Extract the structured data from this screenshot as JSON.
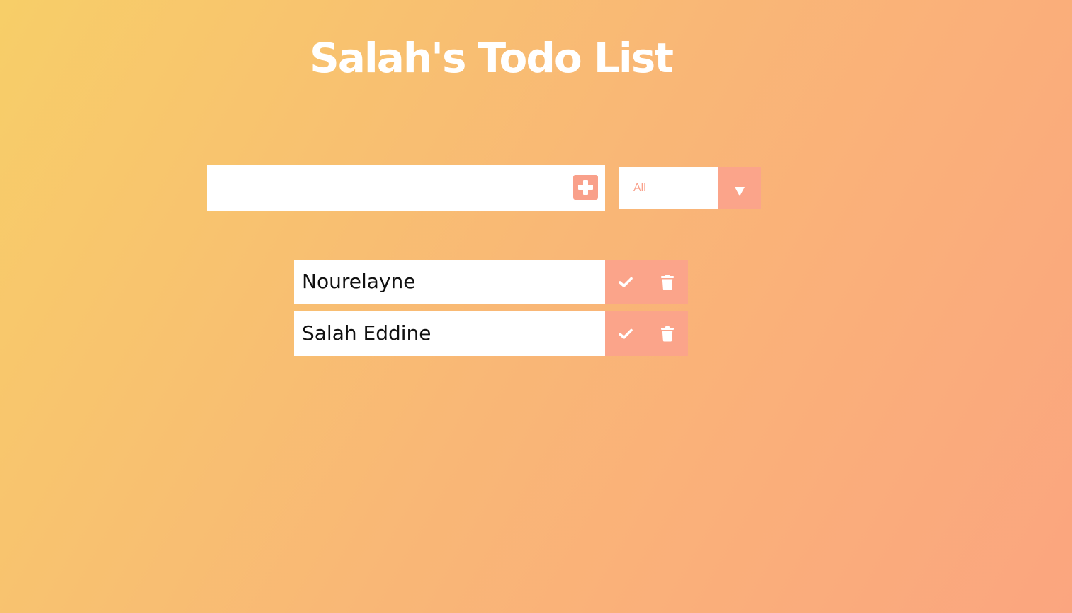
{
  "header": {
    "title": "Salah's Todo List"
  },
  "form": {
    "input_value": "",
    "add_icon": "plus-square-icon"
  },
  "filter": {
    "selected": "All",
    "arrow_icon": "caret-down-icon"
  },
  "todos": [
    {
      "text": "Nourelayne",
      "complete_icon": "check-icon",
      "delete_icon": "trash-icon"
    },
    {
      "text": "Salah Eddine",
      "complete_icon": "check-icon",
      "delete_icon": "trash-icon"
    }
  ],
  "colors": {
    "background_start": "#f7ce68",
    "background_end": "#fba57f",
    "accent": "#fba48a",
    "title_text": "#ffffff",
    "item_text": "#111111"
  }
}
